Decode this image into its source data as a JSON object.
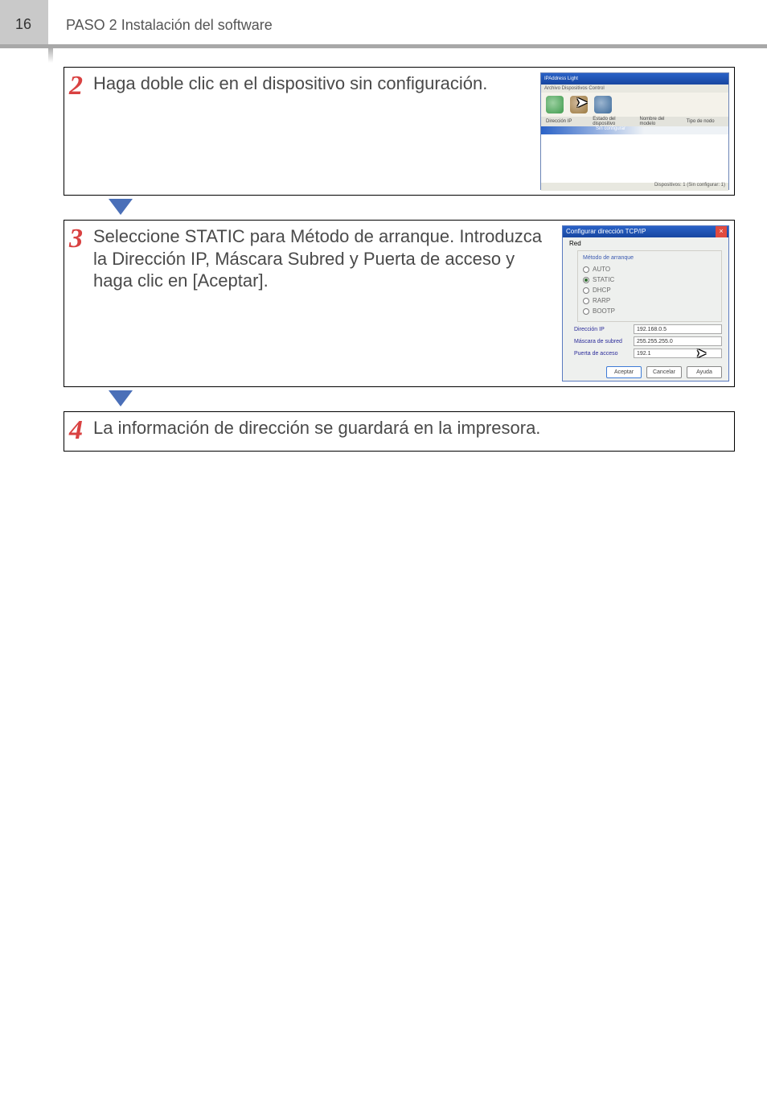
{
  "page_number": "16",
  "header_title": "PASO 2 Instalación del software",
  "steps": {
    "s2": {
      "num": "2",
      "text": "Haga doble clic en el dispositivo sin configuración."
    },
    "s3": {
      "num": "3",
      "text": "Seleccione STATIC para Método de arranque. Introduzca la Dirección IP, Máscara Subred y Puerta de acceso y haga clic en [Aceptar]."
    },
    "s4": {
      "num": "4",
      "text": "La información de dirección se guardará en la impresora."
    }
  },
  "thumb1": {
    "title": "IPAddress Light",
    "menu": "Archivo  Dispositivos  Control",
    "col1": "Dirección IP",
    "col2": "Estado del dispositivo",
    "col3": "Nombre del modelo",
    "col4": "Tipo de nodo",
    "row1": "Sin configurar",
    "status": "Dispositivos: 1 (Sin configurar: 1)"
  },
  "dialog": {
    "title": "Configurar dirección TCP/IP",
    "red_label": "Red",
    "legend": "Método de arranque",
    "r_auto": "AUTO",
    "r_static": "STATIC",
    "r_dhcp": "DHCP",
    "r_rarp": "RARP",
    "r_bootp": "BOOTP",
    "ip_label": "Dirección IP",
    "ip_val": "192.168.0.5",
    "mask_label": "Máscara de subred",
    "mask_val": "255.255.255.0",
    "gw_label": "Puerta de acceso",
    "gw_val": "192.1",
    "btn_ok": "Aceptar",
    "btn_cancel": "Cancelar",
    "btn_help": "Ayuda"
  }
}
